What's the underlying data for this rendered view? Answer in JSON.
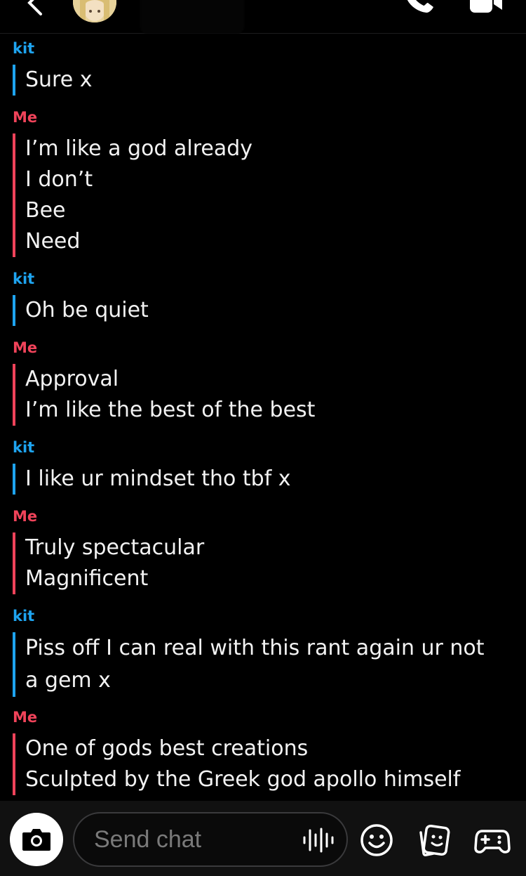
{
  "header": {
    "icons": {
      "back": "chevron-left-icon",
      "call": "phone-icon",
      "video": "video-camera-icon"
    }
  },
  "conversation": [
    {
      "sender": "kit",
      "lines": [
        "Sure x"
      ]
    },
    {
      "sender": "Me",
      "lines": [
        "I’m like a god already",
        "I don’t",
        "Bee",
        "Need"
      ]
    },
    {
      "sender": "kit",
      "lines": [
        "Oh be quiet"
      ]
    },
    {
      "sender": "Me",
      "lines": [
        "Approval",
        "I’m like the best of the best"
      ]
    },
    {
      "sender": "kit",
      "lines": [
        "I like ur mindset tho tbf x"
      ]
    },
    {
      "sender": "Me",
      "lines": [
        "Truly spectacular",
        "Magnificent"
      ]
    },
    {
      "sender": "kit",
      "lines": [
        "Piss off I can real with this rant again ur not a gem x"
      ]
    },
    {
      "sender": "Me",
      "lines": [
        "One of gods best creations",
        "Sculpted by the Greek god apollo himself"
      ]
    }
  ],
  "composer": {
    "placeholder": "Send chat",
    "icons": {
      "camera": "camera-icon",
      "voice": "voice-waveform-icon",
      "emoji": "smiley-icon",
      "stickers": "sticker-icon",
      "games": "gamepad-icon"
    }
  },
  "colors": {
    "kit": "#1ea4f0",
    "me": "#f0435a",
    "background": "#000000"
  }
}
